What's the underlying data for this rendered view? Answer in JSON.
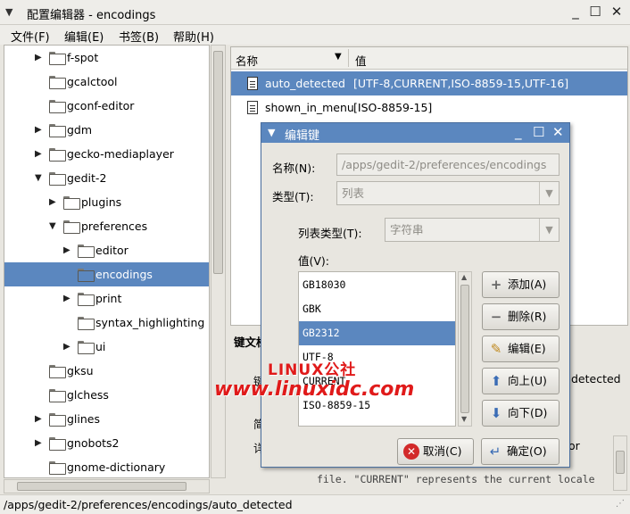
{
  "window": {
    "title": "配置编辑器 - encodings",
    "menu_glyph": "▼",
    "minimize": "_",
    "maximize": "☐",
    "close": "✕"
  },
  "menubar": [
    "文件(F)",
    "编辑(E)",
    "书签(B)",
    "帮助(H)"
  ],
  "tree": [
    {
      "label": "f-spot",
      "level": 0,
      "expander": "▶"
    },
    {
      "label": "gcalctool",
      "level": 0,
      "expander": ""
    },
    {
      "label": "gconf-editor",
      "level": 0,
      "expander": ""
    },
    {
      "label": "gdm",
      "level": 0,
      "expander": "▶"
    },
    {
      "label": "gecko-mediaplayer",
      "level": 0,
      "expander": "▶"
    },
    {
      "label": "gedit-2",
      "level": 0,
      "expander": "▼"
    },
    {
      "label": "plugins",
      "level": 1,
      "expander": "▶"
    },
    {
      "label": "preferences",
      "level": 1,
      "expander": "▼"
    },
    {
      "label": "editor",
      "level": 2,
      "expander": "▶"
    },
    {
      "label": "encodings",
      "level": 2,
      "expander": "",
      "selected": true
    },
    {
      "label": "print",
      "level": 2,
      "expander": "▶"
    },
    {
      "label": "syntax_highlighting",
      "level": 2,
      "expander": ""
    },
    {
      "label": "ui",
      "level": 2,
      "expander": "▶"
    },
    {
      "label": "gksu",
      "level": 0,
      "expander": ""
    },
    {
      "label": "glchess",
      "level": 0,
      "expander": ""
    },
    {
      "label": "glines",
      "level": 0,
      "expander": "▶"
    },
    {
      "label": "gnobots2",
      "level": 0,
      "expander": "▶"
    },
    {
      "label": "gnome-dictionary",
      "level": 0,
      "expander": ""
    }
  ],
  "list": {
    "col_name": "名称",
    "col_value": "值",
    "sort_glyph": "▼",
    "rows": [
      {
        "name": "auto_detected",
        "value": "[UTF-8,CURRENT,ISO-8859-15,UTF-16]",
        "selected": true
      },
      {
        "name": "shown_in_menu",
        "value": "[ISO-8859-15]",
        "selected": false
      }
    ]
  },
  "bottom": {
    "doc_label": "键文档",
    "line1": "键",
    "line1_tail": "detected",
    "line2": "简",
    "line3": "详",
    "line3_tail": "or",
    "line4": "file. \"CURRENT\" represents the current locale"
  },
  "status": "/apps/gedit-2/preferences/encodings/auto_detected",
  "dialog": {
    "title": "编辑键",
    "name_label": "名称(N):",
    "name_value": "/apps/gedit-2/preferences/encodings",
    "type_label": "类型(T):",
    "type_value": "列表",
    "list_type_label": "列表类型(T):",
    "list_type_value": "字符串",
    "values_label": "值(V):",
    "values": [
      "GB18030",
      "GBK",
      "GB2312",
      "UTF-8",
      "CURRENT",
      "ISO-8859-15"
    ],
    "selected_index": 2,
    "buttons": {
      "add": "添加(A)",
      "remove": "删除(R)",
      "edit": "编辑(E)",
      "up": "向上(U)",
      "down": "向下(D)"
    },
    "cancel": "取消(C)",
    "ok": "确定(O)"
  },
  "watermark": {
    "line1": "LINUX公社",
    "line2": "www.linuxidc.com"
  },
  "colors": {
    "selection": "#5b87bf",
    "watermark": "#e01a1a"
  }
}
